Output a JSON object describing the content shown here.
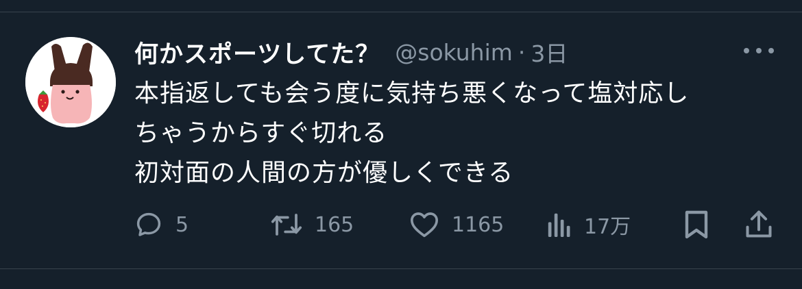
{
  "tweet": {
    "display_name": "何かスポーツしてた？",
    "handle": "@sokuhim",
    "separator": "·",
    "time": "3日",
    "lines": [
      "本指返しても会う度に気持ち悪くなって塩対応し",
      "ちゃうからすぐ切れる",
      "初対面の人間の方が優しくできる"
    ]
  },
  "actions": {
    "reply_count": "5",
    "retweet_count": "165",
    "like_count": "1165",
    "views_count": "17万"
  },
  "icons": {
    "more": "more-options-icon",
    "reply": "reply-icon",
    "retweet": "retweet-icon",
    "like": "heart-icon",
    "views": "views-icon",
    "bookmark": "bookmark-icon",
    "share": "share-icon"
  },
  "colors": {
    "background": "#15202b",
    "secondary_text": "#8b98a5",
    "divider": "#38444d"
  }
}
